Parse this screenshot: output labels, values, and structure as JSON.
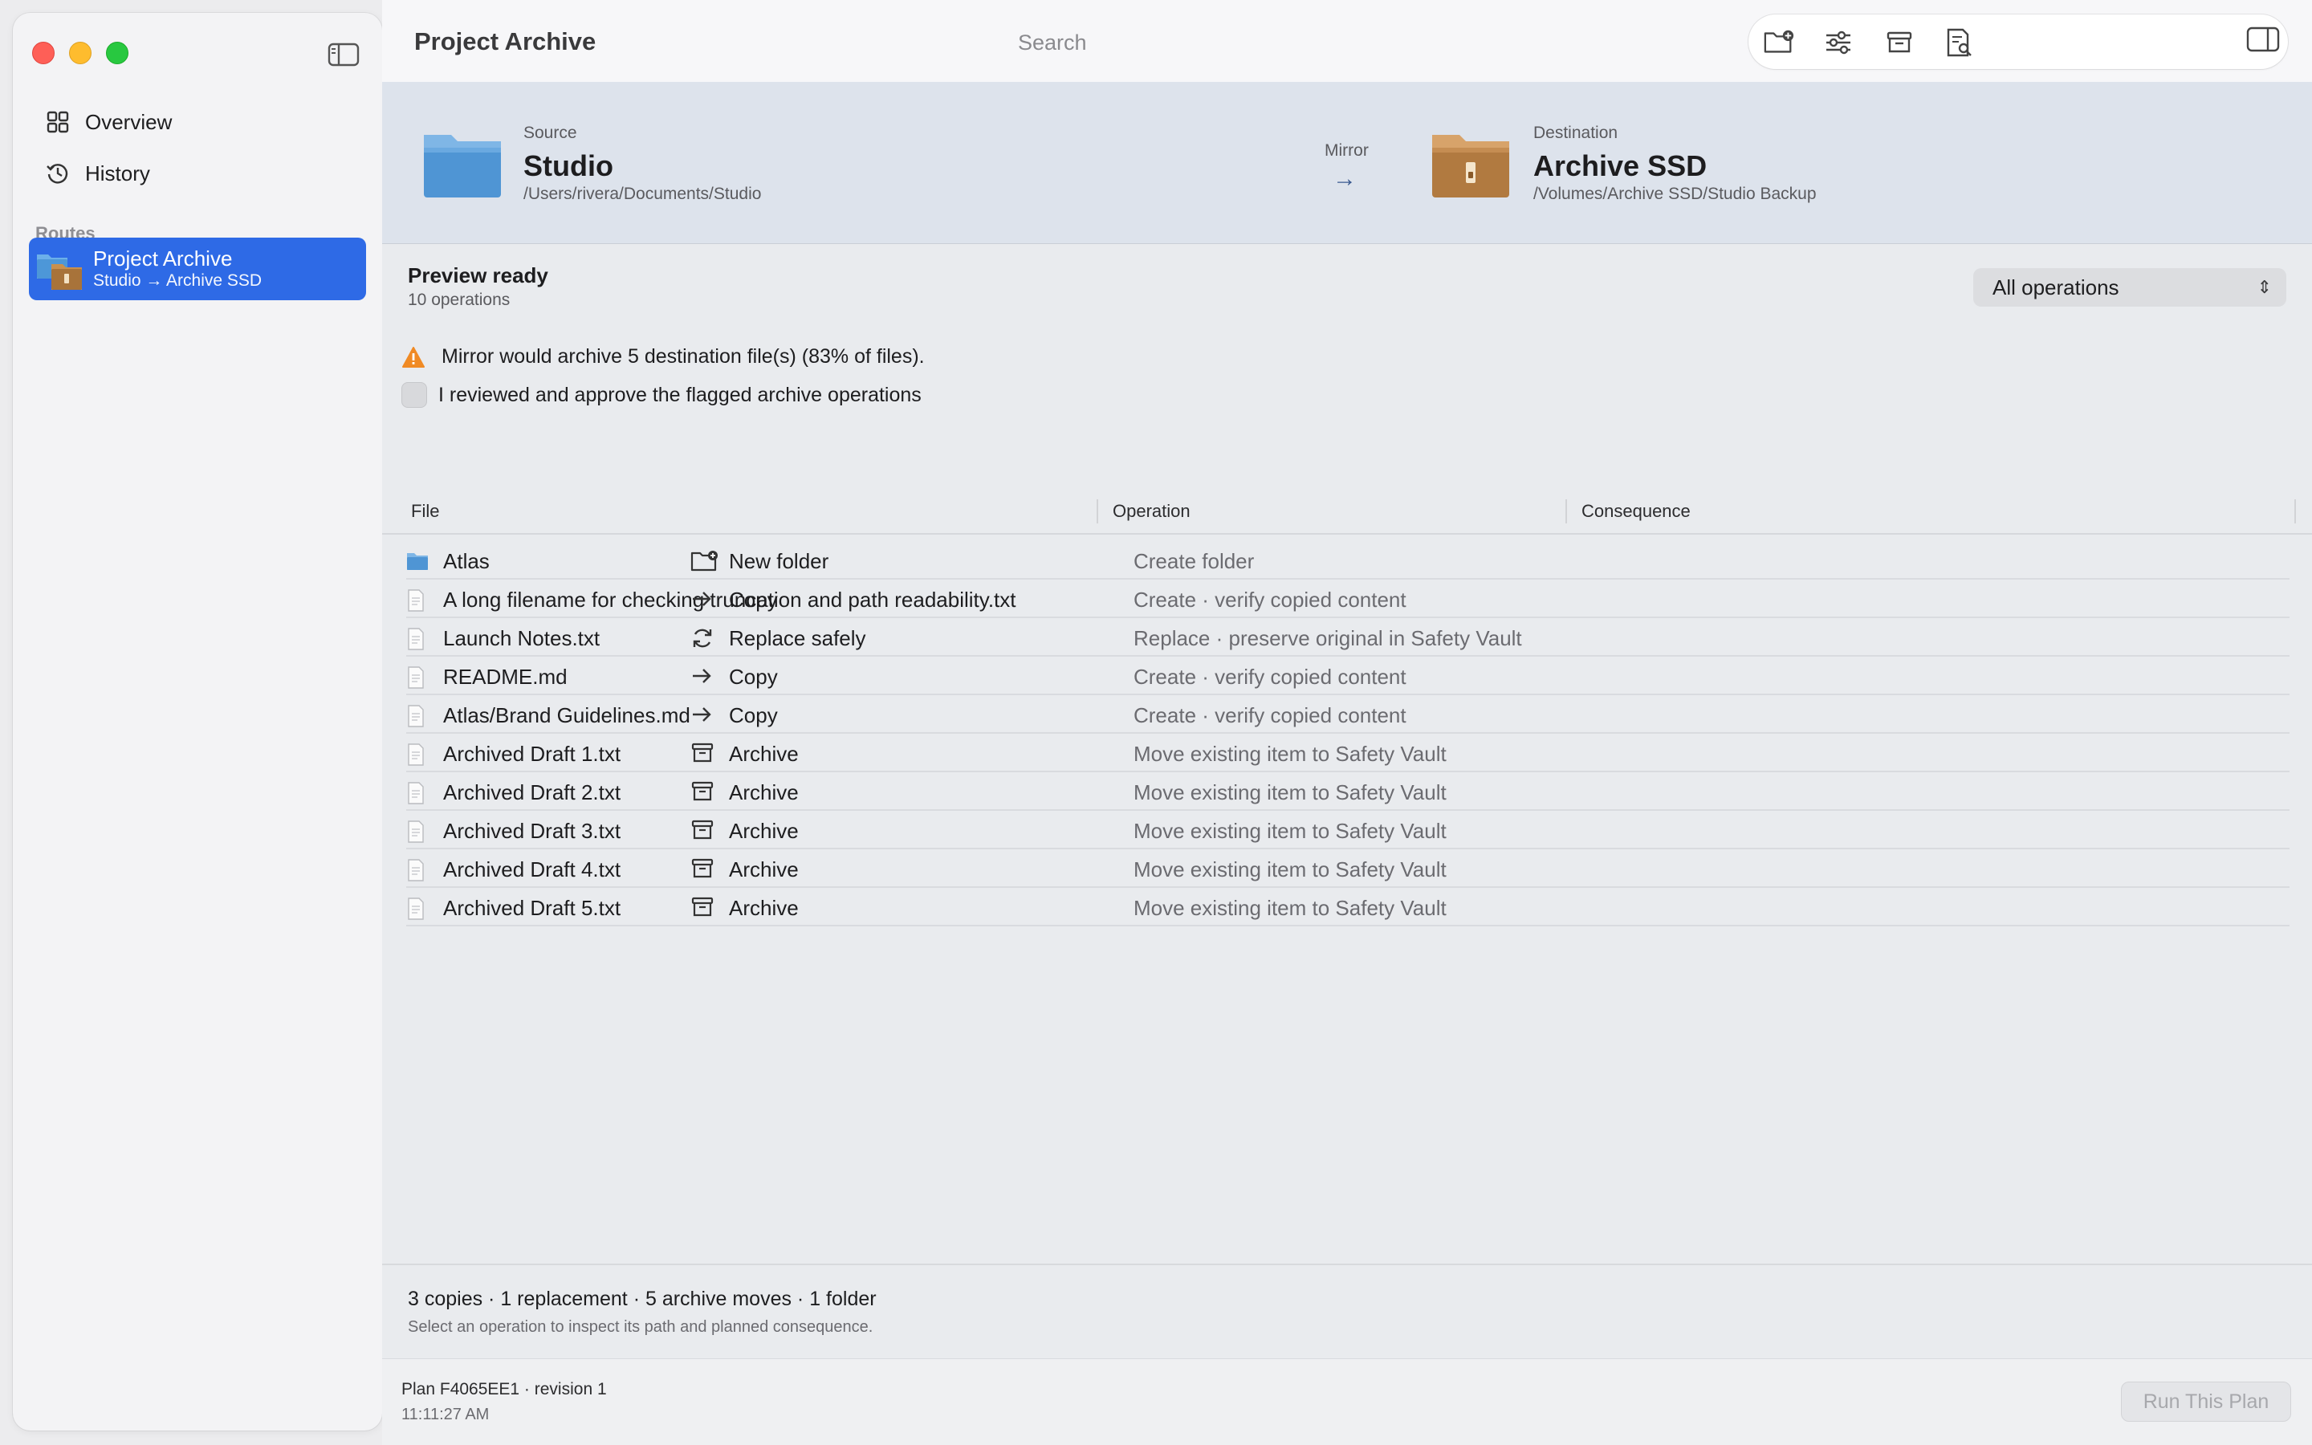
{
  "window": {
    "title": "Project Archive"
  },
  "sidebar": {
    "nav": [
      {
        "label": "Overview",
        "icon": "grid-icon"
      },
      {
        "label": "History",
        "icon": "history-icon"
      }
    ],
    "section_label": "Routes",
    "route": {
      "title": "Project Archive",
      "subtitle": "Studio → Archive SSD"
    }
  },
  "toolbar": {
    "search_placeholder": "Search",
    "buttons": [
      "new-folder-icon",
      "sliders-icon",
      "archive-icon",
      "report-search-icon"
    ]
  },
  "route_header": {
    "source": {
      "label": "Source",
      "name": "Studio",
      "path": "/Users/rivera/Documents/Studio"
    },
    "mode": {
      "label": "Mirror",
      "arrow": "→"
    },
    "destination": {
      "label": "Destination",
      "name": "Archive SSD",
      "path": "/Volumes/Archive SSD/Studio Backup"
    }
  },
  "status": {
    "title": "Preview ready",
    "subtitle": "10 operations",
    "filter": "All operations",
    "warning": "Mirror would archive 5 destination file(s) (83% of files).",
    "approval": "I reviewed and approve the flagged archive operations",
    "approval_checked": false
  },
  "table": {
    "columns": [
      "File",
      "Operation",
      "Consequence"
    ],
    "rows": [
      {
        "file": "Atlas",
        "kind": "folder",
        "op": "New folder",
        "op_icon": "new-folder-icon",
        "consequence": "Create folder"
      },
      {
        "file": "A long filename for checking truncation and path readability.txt",
        "kind": "file",
        "op": "Copy",
        "op_icon": "arrow-right-icon",
        "consequence": "Create · verify copied content"
      },
      {
        "file": "Launch Notes.txt",
        "kind": "file",
        "op": "Replace safely",
        "op_icon": "refresh-icon",
        "consequence": "Replace · preserve original in Safety Vault"
      },
      {
        "file": "README.md",
        "kind": "file",
        "op": "Copy",
        "op_icon": "arrow-right-icon",
        "consequence": "Create · verify copied content"
      },
      {
        "file": "Atlas/Brand Guidelines.md",
        "kind": "file",
        "op": "Copy",
        "op_icon": "arrow-right-icon",
        "consequence": "Create · verify copied content"
      },
      {
        "file": "Archived Draft 1.txt",
        "kind": "file",
        "op": "Archive",
        "op_icon": "archive-box-icon",
        "consequence": "Move existing item to Safety Vault"
      },
      {
        "file": "Archived Draft 2.txt",
        "kind": "file",
        "op": "Archive",
        "op_icon": "archive-box-icon",
        "consequence": "Move existing item to Safety Vault"
      },
      {
        "file": "Archived Draft 3.txt",
        "kind": "file",
        "op": "Archive",
        "op_icon": "archive-box-icon",
        "consequence": "Move existing item to Safety Vault"
      },
      {
        "file": "Archived Draft 4.txt",
        "kind": "file",
        "op": "Archive",
        "op_icon": "archive-box-icon",
        "consequence": "Move existing item to Safety Vault"
      },
      {
        "file": "Archived Draft 5.txt",
        "kind": "file",
        "op": "Archive",
        "op_icon": "archive-box-icon",
        "consequence": "Move existing item to Safety Vault"
      }
    ]
  },
  "summary": {
    "counts": "3 copies · 1 replacement · 5 archive moves · 1 folder",
    "hint": "Select an operation to inspect its path and planned consequence."
  },
  "footer": {
    "plan": "Plan F4065EE1 · revision 1",
    "time": "11:11:27 AM",
    "run_label": "Run This Plan"
  },
  "colors": {
    "accent": "#2e6ae6",
    "warning": "#f08a24",
    "folder_blue": "#5aa0dc",
    "folder_brown": "#b9824a"
  }
}
